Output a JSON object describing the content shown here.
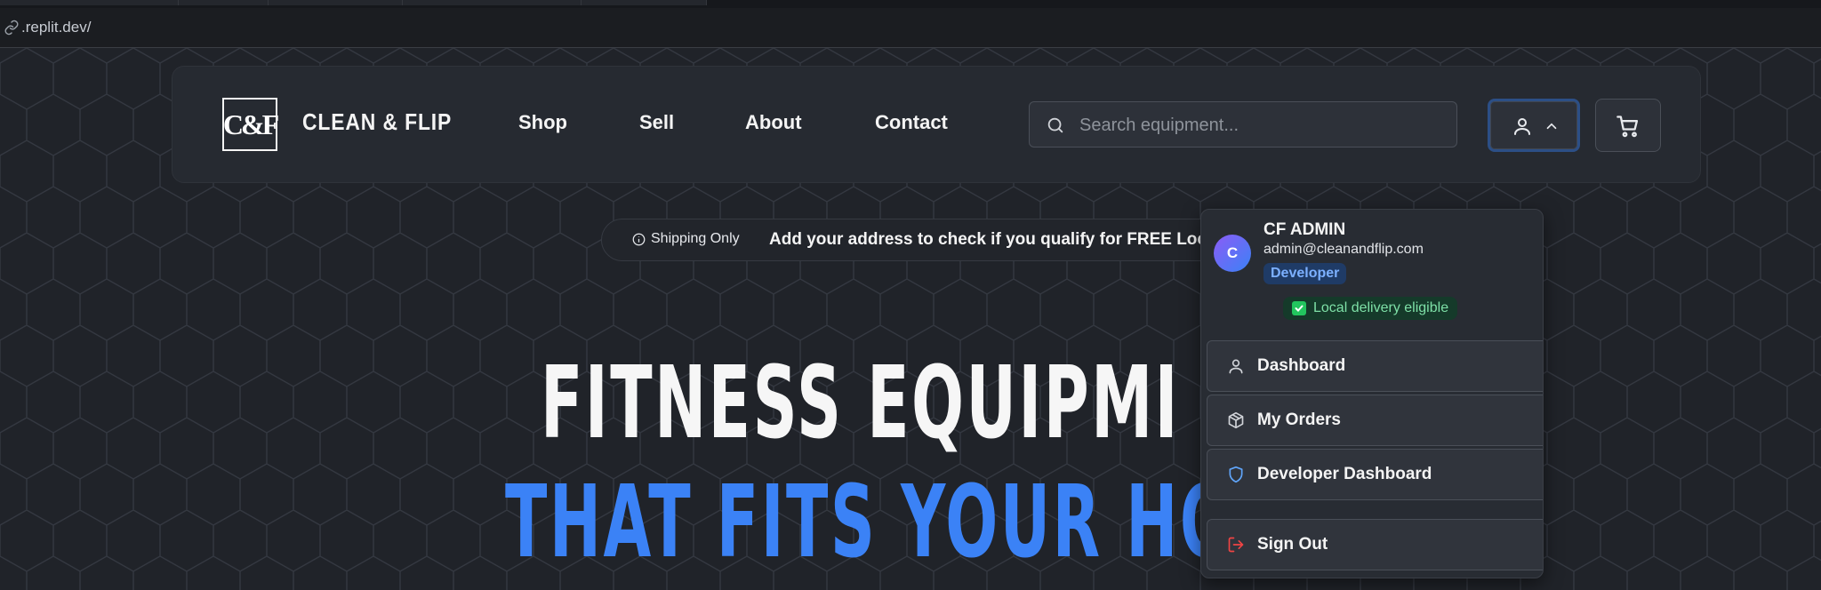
{
  "browser": {
    "url": ".replit.dev/"
  },
  "brand": {
    "logo_mark": "C&F",
    "name": "CLEAN & FLIP"
  },
  "nav": {
    "links": [
      "Shop",
      "Sell",
      "About",
      "Contact"
    ]
  },
  "search": {
    "placeholder": "Search equipment..."
  },
  "banner": {
    "pill": "Shipping Only",
    "message": "Add your address to check if you qualify for FREE Local D"
  },
  "hero": {
    "line1": "FITNESS EQUIPMI",
    "line2": "THAT FITS YOUR HOME"
  },
  "user_menu": {
    "avatar_initial": "C",
    "name": "CF ADMIN",
    "email": "admin@cleanandflip.com",
    "role_badge": "Developer",
    "delivery_badge": "Local delivery eligible",
    "items": [
      {
        "label": "Dashboard",
        "icon": "user-icon"
      },
      {
        "label": "My Orders",
        "icon": "package-icon"
      },
      {
        "label": "Developer Dashboard",
        "icon": "shield-icon"
      },
      {
        "label": "Sign Out",
        "icon": "log-out-icon"
      }
    ]
  },
  "colors": {
    "accent": "#3b82f6",
    "sign_out_icon": "#ef4444",
    "shield_icon": "#60a5fa",
    "eligible_green": "#22c55e"
  }
}
